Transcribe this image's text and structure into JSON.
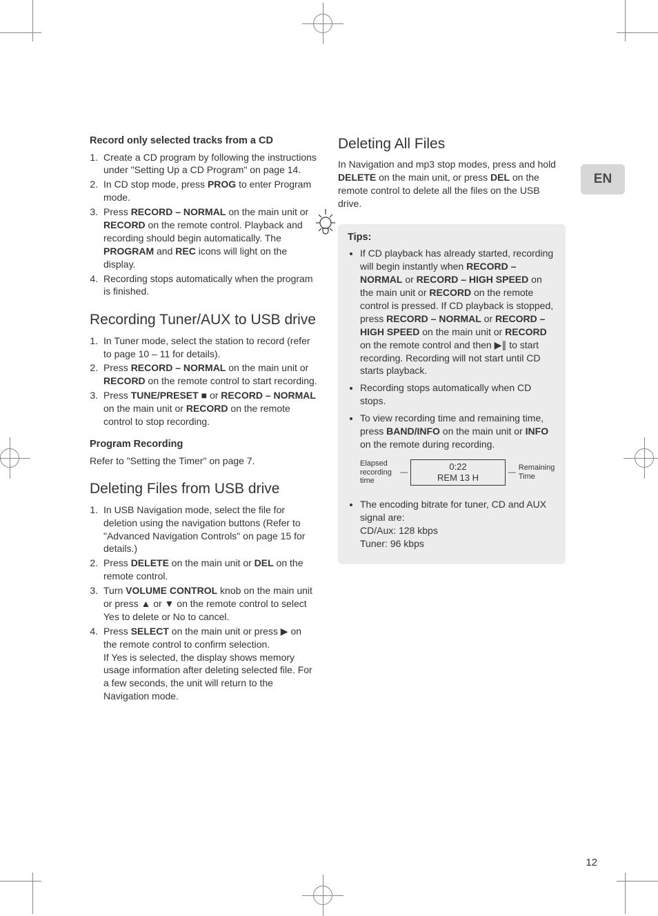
{
  "lang_tab": "EN",
  "page_number": "12",
  "left": {
    "h1": "Record only selected tracks from a CD",
    "list1": {
      "i1a": "Create a CD program by following the instructions under \"Setting Up a CD Program\" on page 14.",
      "i2a": "In CD stop mode, press ",
      "i2b": "PROG",
      "i2c": " to enter Program mode.",
      "i3a": "Press ",
      "i3b": "RECORD – NORMAL",
      "i3c": " on the main unit or ",
      "i3d": "RECORD",
      "i3e": " on the remote control. Playback and recording should begin automatically. The ",
      "i3f": "PROGRAM",
      "i3g": " and ",
      "i3h": "REC",
      "i3i": " icons will light on the display.",
      "i4a": "Recording stops automatically when the program is finished."
    },
    "h2": "Recording Tuner/AUX to USB drive",
    "list2": {
      "i1a": "In Tuner mode, select the station to record (refer to page 10 – 11 for details).",
      "i2a": "Press ",
      "i2b": "RECORD – NORMAL",
      "i2c": " on the main unit or ",
      "i2d": "RECORD",
      "i2e": " on the remote control to start recording.",
      "i3a": "Press ",
      "i3b": "TUNE/PRESET",
      "i3c": " ■ or ",
      "i3d": "RECORD – NORMAL",
      "i3e": " on the main unit or ",
      "i3f": "RECORD",
      "i3g": " on the remote control to stop recording."
    },
    "h3": "Program Recording",
    "p3": "Refer to \"Setting the Timer\" on page 7.",
    "h4": "Deleting Files from USB drive",
    "list4": {
      "i1a": "In USB Navigation mode, select the file for deletion using the navigation buttons (Refer to \"Advanced Navigation Controls\" on page 15 for details.)",
      "i2a": "Press ",
      "i2b": "DELETE",
      "i2c": " on the main unit or ",
      "i2d": "DEL",
      "i2e": " on the remote control.",
      "i3a": "Turn ",
      "i3b": "VOLUME CONTROL",
      "i3c": " knob on the main unit or press ▲ or ▼ on the remote control to select Yes to delete or No to cancel.",
      "i4a": "Press ",
      "i4b": "SELECT",
      "i4c": " on the main unit or press  ▶  on the remote control to confirm selection.",
      "i4d": "If Yes is selected, the display shows memory usage information after deleting selected file. For a few seconds, the unit will return to the Navigation mode."
    }
  },
  "right": {
    "h1": "Deleting All Files",
    "p1a": "In Navigation and mp3 stop modes, press and hold ",
    "p1b": "DELETE",
    "p1c": " on the main unit, or press ",
    "p1d": "DEL",
    "p1e": " on the remote control to delete all the files on the USB drive.",
    "tips_title": "Tips:",
    "tips": {
      "t1a": "If CD playback has already started, recording will begin instantly when ",
      "t1b": "RECORD – NORMAL",
      "t1c": " or ",
      "t1d": "RECORD – HIGH SPEED",
      "t1e": " on the main unit or ",
      "t1f": "RECORD",
      "t1g": " on the remote control is pressed. If CD playback is stopped, press ",
      "t1h": "RECORD – NORMAL",
      "t1i": " or ",
      "t1j": "RECORD – HIGH SPEED",
      "t1k": " on the main unit or ",
      "t1l": "RECORD",
      "t1m": " on the remote control and then  ▶∥  to start recording. Recording will not start until CD starts playback.",
      "t2": "Recording stops automatically when CD stops.",
      "t3a": "To view recording time and remaining time, press ",
      "t3b": "BAND/INFO",
      "t3c": " on the main unit or ",
      "t3d": "INFO",
      "t3e": " on the remote during recording.",
      "lcd_left_label": "Elapsed recording time",
      "lcd_line1": "0:22",
      "lcd_line2": "REM 13 H",
      "lcd_right_label": "Remaining Time",
      "t4a": "The encoding bitrate for tuner, CD and AUX signal are:",
      "t4b": "CD/Aux: 128 kbps",
      "t4c": "Tuner: 96 kbps"
    }
  }
}
